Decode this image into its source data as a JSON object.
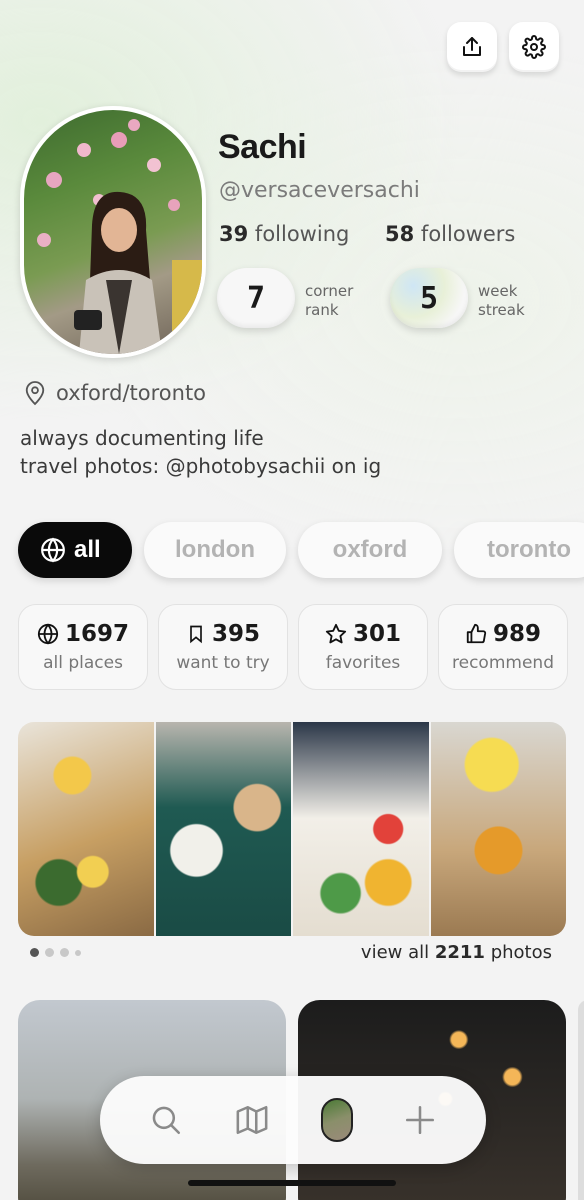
{
  "profile": {
    "name": "Sachi",
    "handle": "@versaceversachi",
    "following_count": "39",
    "following_label": "following",
    "followers_count": "58",
    "followers_label": "followers",
    "corner_rank": "7",
    "corner_rank_label_1": "corner",
    "corner_rank_label_2": "rank",
    "week_streak": "5",
    "week_streak_label_1": "week",
    "week_streak_label_2": "streak",
    "location": "oxford/toronto",
    "bio_line_1": "always documenting life",
    "bio_line_2": "travel photos: @photobysachii on ig"
  },
  "chips": [
    {
      "label": "all",
      "icon": "globe-icon",
      "active": true
    },
    {
      "label": "london",
      "active": false
    },
    {
      "label": "oxford",
      "active": false
    },
    {
      "label": "toronto",
      "active": false
    }
  ],
  "stats": [
    {
      "value": "1697",
      "label": "all places",
      "icon": "globe-icon"
    },
    {
      "value": "395",
      "label": "want to try",
      "icon": "bookmark-icon"
    },
    {
      "value": "301",
      "label": "favorites",
      "icon": "star-icon"
    },
    {
      "value": "989",
      "label": "recommend",
      "icon": "thumbs-up-icon"
    }
  ],
  "photos": {
    "view_all_prefix": "view all",
    "count": "2211",
    "view_all_suffix": "photos"
  },
  "colors": {
    "active_chip": "#0a0a0a",
    "inactive_chip_text": "#b3b3b3"
  }
}
